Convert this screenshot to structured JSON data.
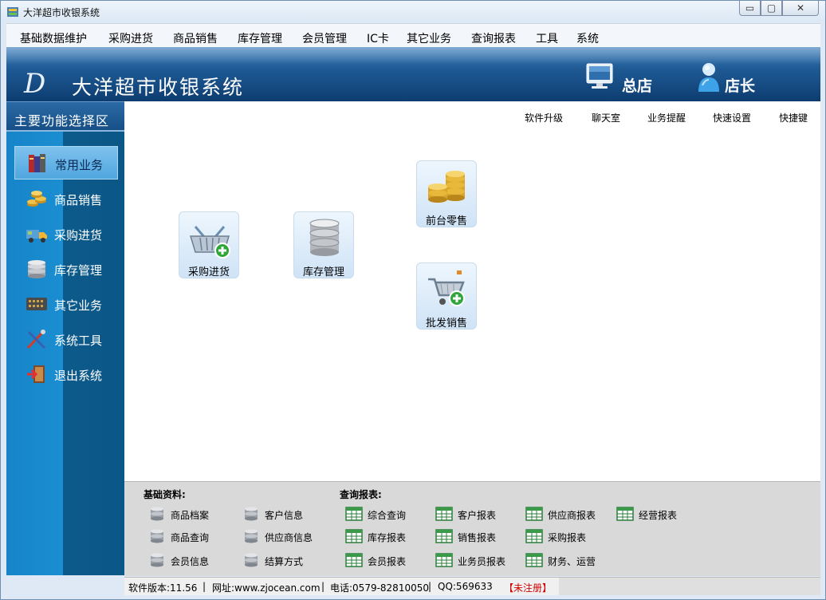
{
  "window": {
    "title": "大洋超市收银系统",
    "min_glyph": "▭",
    "max_glyph": "▢",
    "close_glyph": "✕"
  },
  "menu": [
    "基础数据维护",
    "采购进货",
    "商品销售",
    "库存管理",
    "会员管理",
    "IC卡",
    "其它业务",
    "查询报表",
    "工具",
    "系统"
  ],
  "banner": {
    "logo": "D",
    "app_name": "大洋超市收银系统",
    "store": "总店",
    "user": "店长"
  },
  "sidebar": {
    "title": "主要功能选择区",
    "items": [
      {
        "label": "常用业务",
        "icon": "books-icon",
        "active": true
      },
      {
        "label": "商品销售",
        "icon": "coins-icon"
      },
      {
        "label": "采购进货",
        "icon": "truck-icon"
      },
      {
        "label": "库存管理",
        "icon": "database-icon"
      },
      {
        "label": "其它业务",
        "icon": "calculator-icon"
      },
      {
        "label": "系统工具",
        "icon": "tools-icon"
      },
      {
        "label": "退出系统",
        "icon": "exit-icon"
      }
    ]
  },
  "top_links": [
    "软件升级",
    "聊天室",
    "业务提醒",
    "快速设置",
    "快捷键"
  ],
  "tiles": [
    {
      "label": "采购进货",
      "icon": "basket-add-icon"
    },
    {
      "label": "库存管理",
      "icon": "database-icon"
    },
    {
      "label": "前台零售",
      "icon": "coins-icon"
    },
    {
      "label": "批发销售",
      "icon": "cart-add-icon"
    }
  ],
  "basic": {
    "title": "基础资料:",
    "items": [
      "商品档案",
      "客户信息",
      "商品查询",
      "供应商信息",
      "会员信息",
      "结算方式"
    ]
  },
  "reports": {
    "title": "查询报表:",
    "items": [
      "综合查询",
      "客户报表",
      "供应商报表",
      "经营报表",
      "库存报表",
      "销售报表",
      "采购报表",
      "会员报表",
      "业务员报表",
      "财务、运营"
    ]
  },
  "status": {
    "version": "软件版本:11.56",
    "url": "网址:www.zjocean.com",
    "phone": "电话:0579-82810050",
    "qq": "QQ:569633",
    "reg": "【未注册】"
  },
  "colors": {
    "banner": "#1f5a95",
    "sidebar": "#1784c8",
    "unregistered": "#d40000"
  }
}
